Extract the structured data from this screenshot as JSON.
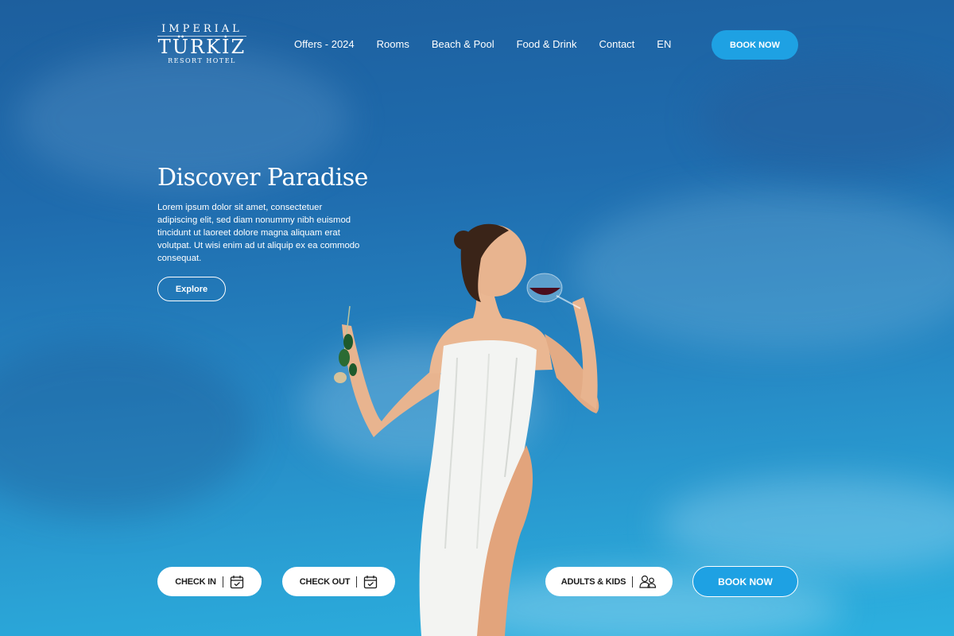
{
  "brand": {
    "top": "IMPERIAL",
    "main": "TÜRKİZ",
    "sub": "RESORT HOTEL"
  },
  "nav": {
    "items": [
      "Offers - 2024",
      "Rooms",
      "Beach & Pool",
      "Food & Drink",
      "Contact",
      "EN"
    ]
  },
  "header": {
    "book_label": "BOOK NOW"
  },
  "hero": {
    "title": "Discover Paradise",
    "text": "Lorem ipsum dolor sit amet, consectetuer adipiscing elit, sed diam nonummy nibh euismod tincidunt ut laoreet dolore magna aliquam erat volutpat. Ut wisi enim ad ut aliquip ex ea commodo consequat.",
    "explore_label": "Explore"
  },
  "booking": {
    "check_in_label": "CHECK IN",
    "check_out_label": "CHECK OUT",
    "guests_label": "ADULTS & KIDS",
    "book_label": "BOOK NOW",
    "icons": [
      "calendar-icon",
      "calendar-icon",
      "guests-icon"
    ]
  },
  "colors": {
    "accent": "#1ea1e3",
    "sky_top": "#1d5f9e",
    "sky_bottom": "#2cb0df"
  }
}
